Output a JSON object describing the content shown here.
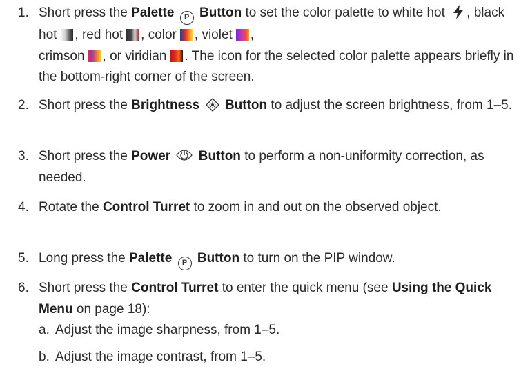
{
  "items": [
    {
      "number": "1.",
      "parts": {
        "a": "Short press the ",
        "b": "Palette",
        "c": "Button",
        "d": " to set the color palette to white hot",
        "e": ", black hot",
        "f": ", red hot",
        "g": ", color",
        "h": ", violet",
        "i": ",",
        "j": "crimson",
        "k": ", or viridian",
        "l": ". The icon for the selected color palette appears briefly in the bottom-right corner of the screen."
      }
    },
    {
      "number": "2.",
      "parts": {
        "a": "Short press the ",
        "b": "Brightness",
        "c": "Button",
        "d": " to adjust the screen brightness, from 1–5."
      }
    },
    {
      "number": "3.",
      "parts": {
        "a": "Short press the ",
        "b": "Power",
        "c": "Button",
        "d": " to perform a non-uniformity correction, as needed."
      }
    },
    {
      "number": "4.",
      "parts": {
        "a": "Rotate the ",
        "b": "Control Turret",
        "c": " to zoom in and out on the observed object."
      }
    },
    {
      "number": "5.",
      "parts": {
        "a": "Long press the ",
        "b": "Palette",
        "c": "Button",
        "d": " to turn on the PIP window."
      }
    },
    {
      "number": "6.",
      "parts": {
        "a": "Short press the ",
        "b": "Control Turret",
        "c": " to enter the quick menu (see ",
        "d": "Using the Quick Menu",
        "e": " on page 18):"
      }
    }
  ],
  "subitems": [
    {
      "letter": "a.",
      "text": "Adjust the image sharpness, from 1–5."
    },
    {
      "letter": "b.",
      "text": "Adjust the image contrast, from 1–5."
    }
  ],
  "icons": {
    "palette_button": "P",
    "brightness_button": "sun-diamond",
    "power_button": "power",
    "white_hot": "bolt"
  },
  "colors": {
    "text": "#2b2b2b"
  }
}
